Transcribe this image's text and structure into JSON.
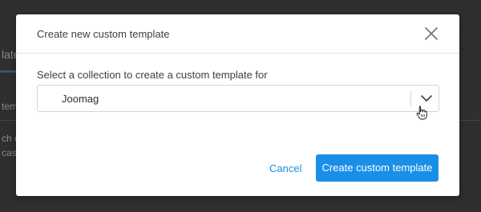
{
  "background": {
    "fragment_1": "late",
    "fragment_2": "tem",
    "fragment_3": "ch c",
    "fragment_4": "cas"
  },
  "modal": {
    "title": "Create new custom template",
    "close_icon": "close-icon",
    "field_label": "Select a collection to create a custom template for",
    "select": {
      "value": "Joomag",
      "arrow_icon": "chevron-down-icon"
    },
    "cancel_label": "Cancel",
    "create_label": "Create custom template"
  },
  "colors": {
    "primary": "#1a8fe8",
    "link": "#1e8fdc",
    "overlay": "#2f2f2f"
  }
}
